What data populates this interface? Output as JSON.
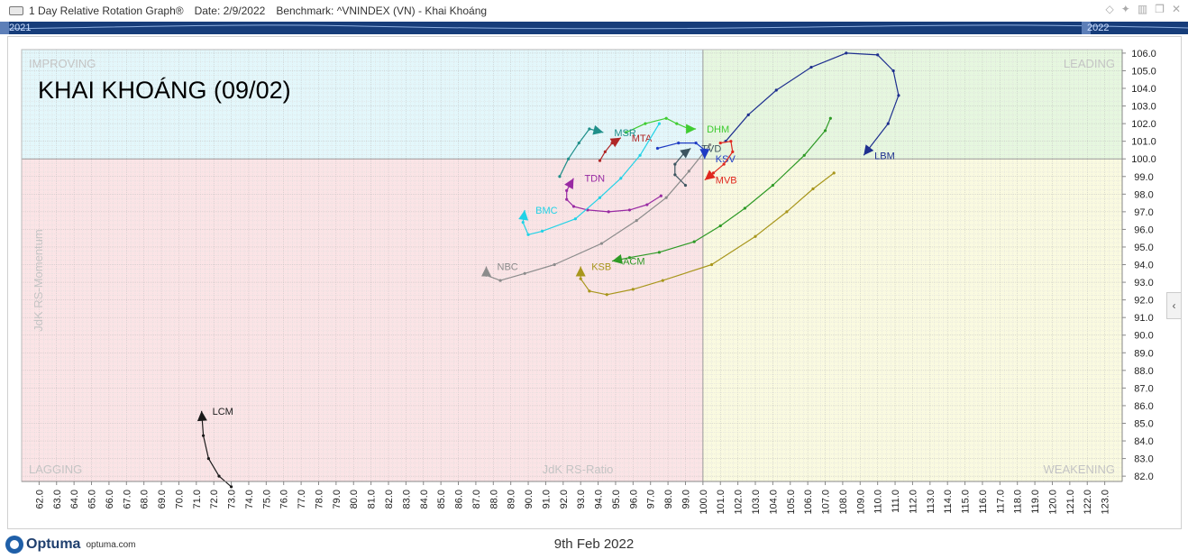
{
  "window": {
    "title": "1 Day Relative Rotation Graph®",
    "date_label": "Date: 2/9/2022",
    "benchmark_label": "Benchmark:  ^VNINDEX (VN) - Khai Khoáng"
  },
  "timeline": {
    "start_year": "2021",
    "end_year": "2022"
  },
  "chart_data": {
    "type": "scatter",
    "title": "KHAI KHOÁNG (09/02)",
    "xlabel": "JdK RS-Ratio",
    "ylabel": "JdK RS-Momentum",
    "xlim": [
      61,
      124
    ],
    "ylim": [
      81.7,
      106.2
    ],
    "center": {
      "x": 100,
      "y": 100
    },
    "x_ticks": [
      "62.0",
      "63.0",
      "64.0",
      "65.0",
      "66.0",
      "67.0",
      "68.0",
      "69.0",
      "70.0",
      "71.0",
      "72.0",
      "73.0",
      "74.0",
      "75.0",
      "76.0",
      "77.0",
      "78.0",
      "79.0",
      "80.0",
      "81.0",
      "82.0",
      "83.0",
      "84.0",
      "85.0",
      "86.0",
      "87.0",
      "88.0",
      "89.0",
      "90.0",
      "91.0",
      "92.0",
      "93.0",
      "94.0",
      "95.0",
      "96.0",
      "97.0",
      "98.0",
      "99.0",
      "100.0",
      "101.0",
      "102.0",
      "103.0",
      "104.0",
      "105.0",
      "106.0",
      "107.0",
      "108.0",
      "109.0",
      "110.0",
      "111.0",
      "112.0",
      "113.0",
      "114.0",
      "115.0",
      "116.0",
      "117.0",
      "118.0",
      "119.0",
      "120.0",
      "121.0",
      "122.0",
      "123.0"
    ],
    "y_ticks": [
      "82.0",
      "83.0",
      "84.0",
      "85.0",
      "86.0",
      "87.0",
      "88.0",
      "89.0",
      "90.0",
      "91.0",
      "92.0",
      "93.0",
      "94.0",
      "95.0",
      "96.0",
      "97.0",
      "98.0",
      "99.0",
      "100.0",
      "101.0",
      "102.0",
      "103.0",
      "104.0",
      "105.0",
      "106.0"
    ],
    "quadrants": {
      "improving": {
        "label": "IMPROVING",
        "color": "#e3f7fb"
      },
      "leading": {
        "label": "LEADING",
        "color": "#e6f7df"
      },
      "lagging": {
        "label": "LAGGING",
        "color": "#fbe4e6"
      },
      "weakening": {
        "label": "WEAKENING",
        "color": "#fafae0"
      }
    },
    "series": [
      {
        "name": "LBM",
        "color": "#1e2f8f",
        "points": [
          [
            101.3,
            101.0
          ],
          [
            102.6,
            102.5
          ],
          [
            104.2,
            103.9
          ],
          [
            106.2,
            105.2
          ],
          [
            108.2,
            106.0
          ],
          [
            110.0,
            105.9
          ],
          [
            110.9,
            105.0
          ],
          [
            111.2,
            103.6
          ],
          [
            110.6,
            102.0
          ],
          [
            109.2,
            100.2
          ]
        ]
      },
      {
        "name": "LCM",
        "color": "#1a1a1a",
        "points": [
          [
            73.0,
            81.4
          ],
          [
            72.3,
            82.0
          ],
          [
            71.7,
            83.0
          ],
          [
            71.4,
            84.3
          ],
          [
            71.3,
            85.7
          ]
        ]
      },
      {
        "name": "ACM",
        "color": "#2e9a26",
        "points": [
          [
            107.3,
            102.3
          ],
          [
            107.0,
            101.6
          ],
          [
            105.8,
            100.2
          ],
          [
            104.0,
            98.5
          ],
          [
            102.4,
            97.2
          ],
          [
            101.0,
            96.2
          ],
          [
            99.5,
            95.3
          ],
          [
            97.5,
            94.7
          ],
          [
            95.8,
            94.4
          ],
          [
            94.8,
            94.2
          ]
        ]
      },
      {
        "name": "KSB",
        "color": "#a8961c",
        "points": [
          [
            107.5,
            99.2
          ],
          [
            106.3,
            98.3
          ],
          [
            104.8,
            97.0
          ],
          [
            103.0,
            95.6
          ],
          [
            100.5,
            94.0
          ],
          [
            97.7,
            93.1
          ],
          [
            96.0,
            92.6
          ],
          [
            94.5,
            92.3
          ],
          [
            93.5,
            92.5
          ],
          [
            93.0,
            93.2
          ],
          [
            93.0,
            93.9
          ]
        ]
      },
      {
        "name": "NBC",
        "color": "#8c8c8c",
        "points": [
          [
            100.4,
            100.8
          ],
          [
            99.2,
            99.3
          ],
          [
            97.9,
            97.8
          ],
          [
            96.2,
            96.5
          ],
          [
            94.2,
            95.2
          ],
          [
            91.5,
            94.0
          ],
          [
            89.8,
            93.5
          ],
          [
            88.4,
            93.1
          ],
          [
            87.6,
            93.4
          ],
          [
            87.6,
            93.9
          ]
        ]
      },
      {
        "name": "TVD",
        "color": "#3d5560",
        "points": [
          [
            99.0,
            98.5
          ],
          [
            98.4,
            99.1
          ],
          [
            98.4,
            99.7
          ],
          [
            98.9,
            100.3
          ],
          [
            99.3,
            100.6
          ]
        ]
      },
      {
        "name": "KSV",
        "color": "#1f3cc4",
        "points": [
          [
            97.4,
            100.6
          ],
          [
            98.6,
            100.9
          ],
          [
            99.6,
            100.9
          ],
          [
            100.1,
            100.5
          ],
          [
            100.1,
            100.0
          ]
        ]
      },
      {
        "name": "MVB",
        "color": "#e0281e",
        "points": [
          [
            101.0,
            100.9
          ],
          [
            101.6,
            101.0
          ],
          [
            101.7,
            100.4
          ],
          [
            101.2,
            99.7
          ],
          [
            100.6,
            99.2
          ],
          [
            100.1,
            98.8
          ]
        ]
      },
      {
        "name": "DHM",
        "color": "#3fcc31",
        "points": [
          [
            95.6,
            101.5
          ],
          [
            96.7,
            102.0
          ],
          [
            97.9,
            102.3
          ],
          [
            98.5,
            102.0
          ],
          [
            99.2,
            101.7
          ],
          [
            99.6,
            101.7
          ]
        ]
      },
      {
        "name": "MSR",
        "color": "#1f8f8a",
        "points": [
          [
            91.8,
            99.0
          ],
          [
            92.3,
            100.0
          ],
          [
            92.9,
            100.9
          ],
          [
            93.5,
            101.7
          ],
          [
            94.3,
            101.5
          ]
        ]
      },
      {
        "name": "MTA",
        "color": "#b02727",
        "points": [
          [
            94.1,
            99.9
          ],
          [
            94.4,
            100.4
          ],
          [
            94.8,
            100.9
          ],
          [
            95.3,
            101.2
          ]
        ]
      },
      {
        "name": "TDN",
        "color": "#992aa3",
        "points": [
          [
            97.6,
            97.9
          ],
          [
            96.8,
            97.4
          ],
          [
            95.8,
            97.1
          ],
          [
            94.6,
            97.0
          ],
          [
            93.4,
            97.1
          ],
          [
            92.6,
            97.3
          ],
          [
            92.2,
            97.7
          ],
          [
            92.2,
            98.2
          ],
          [
            92.6,
            98.9
          ]
        ]
      },
      {
        "name": "BMC",
        "color": "#22d2e6",
        "points": [
          [
            97.5,
            102.0
          ],
          [
            96.4,
            100.2
          ],
          [
            95.3,
            98.9
          ],
          [
            94.1,
            97.8
          ],
          [
            92.7,
            96.6
          ],
          [
            90.8,
            95.9
          ],
          [
            90.0,
            95.7
          ],
          [
            89.7,
            96.4
          ],
          [
            89.8,
            97.1
          ]
        ]
      }
    ]
  },
  "footer": {
    "brand": "Optuma",
    "url": "optuma.com",
    "date": "9th Feb 2022",
    "brand_color": "#1f5fa8"
  }
}
